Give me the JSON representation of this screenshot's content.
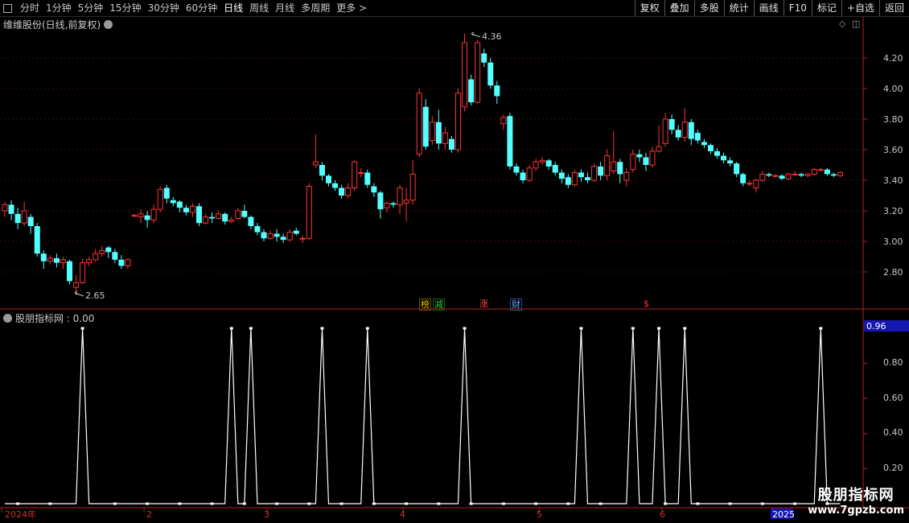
{
  "toolbar": {
    "tabs": [
      "分时",
      "1分钟",
      "5分钟",
      "15分钟",
      "30分钟",
      "60分钟",
      "日线",
      "周线",
      "月线",
      "多周期",
      "更多 >"
    ],
    "active_tab": "日线",
    "right_buttons": [
      "复权",
      "叠加",
      "多股",
      "统计",
      "画线",
      "F10",
      "标记",
      "+自选",
      "返回"
    ]
  },
  "main_chart": {
    "title": "维维股份(日线,前复权)",
    "y_ticks": [
      "4.20",
      "4.00",
      "3.80",
      "3.60",
      "3.40",
      "3.20",
      "3.00",
      "2.80"
    ],
    "high_label": "4.36",
    "low_label": "2.65",
    "tags": [
      {
        "text": "榜",
        "color": "#e8c200"
      },
      {
        "text": "减",
        "color": "#33cc33"
      },
      {
        "text": "涨",
        "color": "#ff4444"
      },
      {
        "text": "财",
        "color": "#6fa8ff"
      },
      {
        "text": "$",
        "color": "#ff3333"
      }
    ]
  },
  "indicator": {
    "title": "股朋指标网 : 0.00",
    "current_value": "0.96",
    "y_ticks": [
      "0.80",
      "0.60",
      "0.40",
      "0.20"
    ]
  },
  "x_axis": {
    "labels": [
      "2024年",
      "2",
      "3",
      "4",
      "5",
      "6"
    ],
    "right_label": "2025"
  },
  "watermark": {
    "line1": "股朋指标网",
    "line2": "www.7gpzb.com"
  },
  "chart_data": {
    "type": "candlestick",
    "title": "维维股份(日线,前复权)",
    "ylim": [
      2.62,
      4.45
    ],
    "y_ticks": [
      4.2,
      4.0,
      3.8,
      3.6,
      3.4,
      3.2,
      3.0,
      2.8
    ],
    "colors": {
      "up": "#ff3232",
      "down": "#54ffff"
    },
    "candles": [
      [
        3.2,
        3.24,
        3.26,
        3.16
      ],
      [
        3.24,
        3.18,
        3.27,
        3.14
      ],
      [
        3.18,
        3.12,
        3.22,
        3.08
      ],
      [
        3.12,
        3.2,
        3.26,
        3.1
      ],
      [
        3.16,
        3.1,
        3.18,
        3.05
      ],
      [
        3.1,
        2.92,
        3.12,
        2.9
      ],
      [
        2.92,
        2.87,
        2.94,
        2.82
      ],
      [
        2.87,
        2.89,
        2.91,
        2.85
      ],
      [
        2.89,
        2.86,
        2.92,
        2.83
      ],
      [
        2.86,
        2.88,
        2.9,
        2.82
      ],
      [
        2.87,
        2.74,
        2.88,
        2.72
      ],
      [
        2.7,
        2.73,
        2.78,
        2.65
      ],
      [
        2.73,
        2.86,
        2.89,
        2.72
      ],
      [
        2.86,
        2.88,
        2.9,
        2.84
      ],
      [
        2.88,
        2.92,
        2.95,
        2.87
      ],
      [
        2.92,
        2.94,
        2.97,
        2.9
      ],
      [
        2.96,
        2.93,
        2.97,
        2.89
      ],
      [
        2.93,
        2.88,
        2.95,
        2.86
      ],
      [
        2.88,
        2.84,
        2.91,
        2.82
      ],
      [
        2.84,
        2.88,
        2.89,
        2.82
      ],
      [
        3.17,
        3.17,
        3.18,
        3.16
      ],
      [
        3.16,
        3.18,
        3.21,
        3.12
      ],
      [
        3.17,
        3.14,
        3.2,
        3.09
      ],
      [
        3.14,
        3.21,
        3.24,
        3.12
      ],
      [
        3.21,
        3.34,
        3.36,
        3.19
      ],
      [
        3.35,
        3.28,
        3.37,
        3.25
      ],
      [
        3.27,
        3.25,
        3.29,
        3.23
      ],
      [
        3.26,
        3.22,
        3.27,
        3.19
      ],
      [
        3.22,
        3.19,
        3.24,
        3.17
      ],
      [
        3.19,
        3.23,
        3.25,
        3.16
      ],
      [
        3.23,
        3.12,
        3.25,
        3.1
      ],
      [
        3.12,
        3.16,
        3.18,
        3.11
      ],
      [
        3.16,
        3.15,
        3.19,
        3.12
      ],
      [
        3.15,
        3.18,
        3.2,
        3.14
      ],
      [
        3.18,
        3.13,
        3.19,
        3.11
      ],
      [
        3.13,
        3.14,
        3.16,
        3.12
      ],
      [
        3.15,
        3.2,
        3.22,
        3.14
      ],
      [
        3.2,
        3.16,
        3.24,
        3.15
      ],
      [
        3.16,
        3.1,
        3.17,
        3.08
      ],
      [
        3.1,
        3.06,
        3.12,
        3.04
      ],
      [
        3.06,
        3.02,
        3.08,
        3.0
      ],
      [
        3.02,
        3.05,
        3.07,
        3.01
      ],
      [
        3.05,
        3.03,
        3.08,
        3.0
      ],
      [
        3.03,
        3.01,
        3.05,
        2.99
      ],
      [
        3.01,
        3.06,
        3.08,
        3.0
      ],
      [
        3.07,
        3.05,
        3.09,
        3.04
      ],
      [
        3.02,
        3.02,
        3.04,
        2.99
      ],
      [
        3.02,
        3.36,
        3.38,
        3.01
      ],
      [
        3.5,
        3.52,
        3.7,
        3.48
      ],
      [
        3.5,
        3.43,
        3.52,
        3.4
      ],
      [
        3.43,
        3.38,
        3.44,
        3.36
      ],
      [
        3.38,
        3.35,
        3.4,
        3.33
      ],
      [
        3.35,
        3.3,
        3.37,
        3.28
      ],
      [
        3.3,
        3.35,
        3.38,
        3.28
      ],
      [
        3.35,
        3.52,
        3.53,
        3.33
      ],
      [
        3.45,
        3.45,
        3.48,
        3.42
      ],
      [
        3.45,
        3.37,
        3.47,
        3.35
      ],
      [
        3.36,
        3.32,
        3.38,
        3.29
      ],
      [
        3.32,
        3.21,
        3.33,
        3.15
      ],
      [
        3.22,
        3.25,
        3.26,
        3.19
      ],
      [
        3.25,
        3.24,
        3.26,
        3.22
      ],
      [
        3.24,
        3.35,
        3.37,
        3.18
      ],
      [
        3.25,
        3.27,
        3.35,
        3.13
      ],
      [
        3.27,
        3.44,
        3.53,
        3.24
      ],
      [
        3.57,
        3.97,
        4.0,
        3.55
      ],
      [
        3.88,
        3.62,
        3.93,
        3.6
      ],
      [
        3.66,
        3.78,
        3.82,
        3.63
      ],
      [
        3.78,
        3.64,
        3.86,
        3.6
      ],
      [
        3.64,
        3.71,
        3.75,
        3.6
      ],
      [
        3.67,
        3.6,
        3.69,
        3.58
      ],
      [
        3.6,
        3.97,
        4.0,
        3.58
      ],
      [
        3.88,
        4.3,
        4.36,
        3.85
      ],
      [
        4.06,
        3.91,
        4.09,
        3.89
      ],
      [
        3.91,
        4.3,
        4.32,
        3.9
      ],
      [
        4.23,
        4.17,
        4.26,
        4.14
      ],
      [
        4.17,
        4.02,
        4.2,
        4.0
      ],
      [
        4.02,
        3.95,
        4.05,
        3.9
      ],
      [
        3.77,
        3.81,
        3.83,
        3.73
      ],
      [
        3.82,
        3.49,
        3.84,
        3.47
      ],
      [
        3.49,
        3.45,
        3.51,
        3.43
      ],
      [
        3.45,
        3.4,
        3.47,
        3.38
      ],
      [
        3.4,
        3.48,
        3.5,
        3.39
      ],
      [
        3.48,
        3.52,
        3.54,
        3.46
      ],
      [
        3.52,
        3.53,
        3.55,
        3.5
      ],
      [
        3.53,
        3.49,
        3.54,
        3.47
      ],
      [
        3.5,
        3.45,
        3.52,
        3.43
      ],
      [
        3.45,
        3.41,
        3.47,
        3.38
      ],
      [
        3.42,
        3.37,
        3.44,
        3.35
      ],
      [
        3.37,
        3.45,
        3.47,
        3.36
      ],
      [
        3.45,
        3.42,
        3.47,
        3.39
      ],
      [
        3.42,
        3.4,
        3.45,
        3.38
      ],
      [
        3.4,
        3.49,
        3.51,
        3.39
      ],
      [
        3.49,
        3.43,
        3.52,
        3.4
      ],
      [
        3.43,
        3.56,
        3.6,
        3.4
      ],
      [
        3.46,
        3.52,
        3.72,
        3.44
      ],
      [
        3.52,
        3.44,
        3.54,
        3.38
      ],
      [
        3.4,
        3.45,
        3.48,
        3.36
      ],
      [
        3.47,
        3.57,
        3.6,
        3.45
      ],
      [
        3.57,
        3.55,
        3.6,
        3.52
      ],
      [
        3.55,
        3.5,
        3.58,
        3.46
      ],
      [
        3.5,
        3.59,
        3.62,
        3.48
      ],
      [
        3.59,
        3.62,
        3.76,
        3.58
      ],
      [
        3.64,
        3.8,
        3.84,
        3.62
      ],
      [
        3.8,
        3.73,
        3.83,
        3.7
      ],
      [
        3.73,
        3.68,
        3.76,
        3.66
      ],
      [
        3.68,
        3.78,
        3.87,
        3.65
      ],
      [
        3.78,
        3.67,
        3.8,
        3.63
      ],
      [
        3.71,
        3.66,
        3.73,
        3.64
      ],
      [
        3.65,
        3.63,
        3.67,
        3.61
      ],
      [
        3.63,
        3.59,
        3.64,
        3.57
      ],
      [
        3.59,
        3.56,
        3.61,
        3.54
      ],
      [
        3.56,
        3.53,
        3.58,
        3.51
      ],
      [
        3.53,
        3.51,
        3.55,
        3.49
      ],
      [
        3.51,
        3.44,
        3.52,
        3.42
      ],
      [
        3.44,
        3.38,
        3.45,
        3.36
      ],
      [
        3.38,
        3.38,
        3.4,
        3.36
      ],
      [
        3.35,
        3.4,
        3.41,
        3.32
      ],
      [
        3.4,
        3.44,
        3.46,
        3.39
      ],
      [
        3.44,
        3.43,
        3.45,
        3.42
      ],
      [
        3.43,
        3.43,
        3.44,
        3.42
      ],
      [
        3.43,
        3.41,
        3.44,
        3.4
      ],
      [
        3.41,
        3.44,
        3.45,
        3.4
      ],
      [
        3.44,
        3.44,
        3.46,
        3.43
      ],
      [
        3.44,
        3.43,
        3.45,
        3.42
      ],
      [
        3.43,
        3.44,
        3.45,
        3.42
      ],
      [
        3.44,
        3.47,
        3.48,
        3.43
      ],
      [
        3.47,
        3.47,
        3.48,
        3.46
      ],
      [
        3.47,
        3.44,
        3.48,
        3.43
      ],
      [
        3.44,
        3.43,
        3.45,
        3.42
      ],
      [
        3.43,
        3.45,
        3.46,
        3.42
      ]
    ],
    "indicator_ylim": [
      0,
      1.0
    ],
    "indicator_peaks": [
      12,
      35,
      38,
      49,
      56,
      71,
      89,
      97,
      101,
      105,
      126
    ]
  }
}
